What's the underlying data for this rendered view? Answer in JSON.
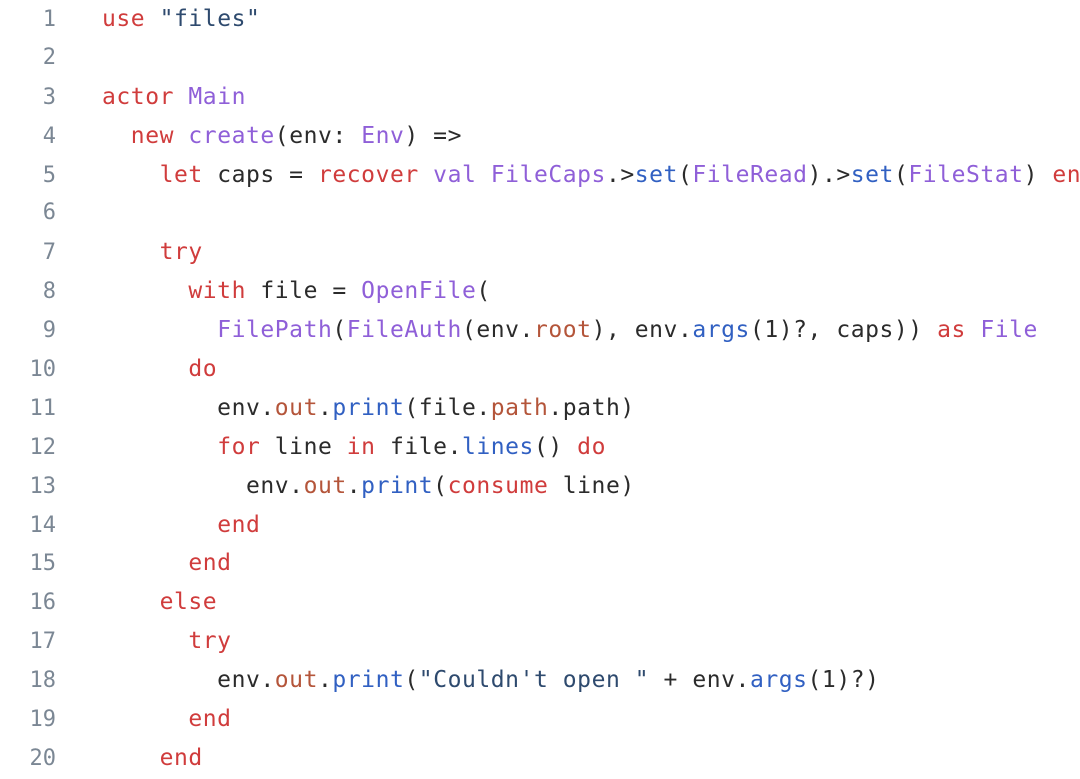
{
  "editor": {
    "language": "pony",
    "background_color": "#ffffff",
    "gutter_color": "#7b8794",
    "default_text_color": "#2b2b2b",
    "palette": {
      "keyword": "#d03c3c",
      "type": "#8f5fd8",
      "method": "#3160c2",
      "field": "#b4553a",
      "string": "#2e4a6e",
      "plain": "#2b2b2b"
    },
    "line_count": 20,
    "lines": [
      {
        "number": "1",
        "text": "use \"files\"",
        "tokens": [
          {
            "t": "use",
            "c": "kw"
          },
          {
            "t": " ",
            "c": "plain"
          },
          {
            "t": "\"files\"",
            "c": "string"
          }
        ]
      },
      {
        "number": "2",
        "text": "",
        "tokens": []
      },
      {
        "number": "3",
        "text": "actor Main",
        "tokens": [
          {
            "t": "actor",
            "c": "kw"
          },
          {
            "t": " ",
            "c": "plain"
          },
          {
            "t": "Main",
            "c": "type"
          }
        ]
      },
      {
        "number": "4",
        "text": "  new create(env: Env) =>",
        "tokens": [
          {
            "t": "  ",
            "c": "plain"
          },
          {
            "t": "new",
            "c": "kw"
          },
          {
            "t": " ",
            "c": "plain"
          },
          {
            "t": "create",
            "c": "type"
          },
          {
            "t": "(env: ",
            "c": "plain"
          },
          {
            "t": "Env",
            "c": "type"
          },
          {
            "t": ") =>",
            "c": "plain"
          }
        ]
      },
      {
        "number": "5",
        "text": "    let caps = recover val FileCaps.>set(FileRead).>set(FileStat) end",
        "tokens": [
          {
            "t": "    ",
            "c": "plain"
          },
          {
            "t": "let",
            "c": "kw"
          },
          {
            "t": " caps = ",
            "c": "plain"
          },
          {
            "t": "recover",
            "c": "kw"
          },
          {
            "t": " ",
            "c": "plain"
          },
          {
            "t": "val",
            "c": "type"
          },
          {
            "t": " ",
            "c": "plain"
          },
          {
            "t": "FileCaps",
            "c": "type"
          },
          {
            "t": ".>",
            "c": "plain"
          },
          {
            "t": "set",
            "c": "method"
          },
          {
            "t": "(",
            "c": "plain"
          },
          {
            "t": "FileRead",
            "c": "type"
          },
          {
            "t": ").>",
            "c": "plain"
          },
          {
            "t": "set",
            "c": "method"
          },
          {
            "t": "(",
            "c": "plain"
          },
          {
            "t": "FileStat",
            "c": "type"
          },
          {
            "t": ") ",
            "c": "plain"
          },
          {
            "t": "end",
            "c": "kw"
          }
        ]
      },
      {
        "number": "6",
        "text": "",
        "tokens": []
      },
      {
        "number": "7",
        "text": "    try",
        "tokens": [
          {
            "t": "    ",
            "c": "plain"
          },
          {
            "t": "try",
            "c": "kw"
          }
        ]
      },
      {
        "number": "8",
        "text": "      with file = OpenFile(",
        "tokens": [
          {
            "t": "      ",
            "c": "plain"
          },
          {
            "t": "with",
            "c": "kw"
          },
          {
            "t": " file = ",
            "c": "plain"
          },
          {
            "t": "OpenFile",
            "c": "type"
          },
          {
            "t": "(",
            "c": "plain"
          }
        ]
      },
      {
        "number": "9",
        "text": "        FilePath(FileAuth(env.root), env.args(1)?, caps)) as File",
        "tokens": [
          {
            "t": "        ",
            "c": "plain"
          },
          {
            "t": "FilePath",
            "c": "type"
          },
          {
            "t": "(",
            "c": "plain"
          },
          {
            "t": "FileAuth",
            "c": "type"
          },
          {
            "t": "(env.",
            "c": "plain"
          },
          {
            "t": "root",
            "c": "field"
          },
          {
            "t": "), env.",
            "c": "plain"
          },
          {
            "t": "args",
            "c": "method"
          },
          {
            "t": "(1)?, caps)) ",
            "c": "plain"
          },
          {
            "t": "as",
            "c": "kw"
          },
          {
            "t": " ",
            "c": "plain"
          },
          {
            "t": "File",
            "c": "type"
          }
        ]
      },
      {
        "number": "10",
        "text": "      do",
        "tokens": [
          {
            "t": "      ",
            "c": "plain"
          },
          {
            "t": "do",
            "c": "kw"
          }
        ]
      },
      {
        "number": "11",
        "text": "        env.out.print(file.path.path)",
        "tokens": [
          {
            "t": "        env.",
            "c": "plain"
          },
          {
            "t": "out",
            "c": "field"
          },
          {
            "t": ".",
            "c": "plain"
          },
          {
            "t": "print",
            "c": "method"
          },
          {
            "t": "(file.",
            "c": "plain"
          },
          {
            "t": "path",
            "c": "field"
          },
          {
            "t": ".path)",
            "c": "plain"
          }
        ]
      },
      {
        "number": "12",
        "text": "        for line in file.lines() do",
        "tokens": [
          {
            "t": "        ",
            "c": "plain"
          },
          {
            "t": "for",
            "c": "kw"
          },
          {
            "t": " line ",
            "c": "plain"
          },
          {
            "t": "in",
            "c": "kw"
          },
          {
            "t": " file.",
            "c": "plain"
          },
          {
            "t": "lines",
            "c": "method"
          },
          {
            "t": "() ",
            "c": "plain"
          },
          {
            "t": "do",
            "c": "kw"
          }
        ]
      },
      {
        "number": "13",
        "text": "          env.out.print(consume line)",
        "tokens": [
          {
            "t": "          env.",
            "c": "plain"
          },
          {
            "t": "out",
            "c": "field"
          },
          {
            "t": ".",
            "c": "plain"
          },
          {
            "t": "print",
            "c": "method"
          },
          {
            "t": "(",
            "c": "plain"
          },
          {
            "t": "consume",
            "c": "kw"
          },
          {
            "t": " line)",
            "c": "plain"
          }
        ]
      },
      {
        "number": "14",
        "text": "        end",
        "tokens": [
          {
            "t": "        ",
            "c": "plain"
          },
          {
            "t": "end",
            "c": "kw"
          }
        ]
      },
      {
        "number": "15",
        "text": "      end",
        "tokens": [
          {
            "t": "      ",
            "c": "plain"
          },
          {
            "t": "end",
            "c": "kw"
          }
        ]
      },
      {
        "number": "16",
        "text": "    else",
        "tokens": [
          {
            "t": "    ",
            "c": "plain"
          },
          {
            "t": "else",
            "c": "kw"
          }
        ]
      },
      {
        "number": "17",
        "text": "      try",
        "tokens": [
          {
            "t": "      ",
            "c": "plain"
          },
          {
            "t": "try",
            "c": "kw"
          }
        ]
      },
      {
        "number": "18",
        "text": "        env.out.print(\"Couldn't open \" + env.args(1)?)",
        "tokens": [
          {
            "t": "        env.",
            "c": "plain"
          },
          {
            "t": "out",
            "c": "field"
          },
          {
            "t": ".",
            "c": "plain"
          },
          {
            "t": "print",
            "c": "method"
          },
          {
            "t": "(",
            "c": "plain"
          },
          {
            "t": "\"Couldn't open \"",
            "c": "string"
          },
          {
            "t": " + env.",
            "c": "plain"
          },
          {
            "t": "args",
            "c": "method"
          },
          {
            "t": "(1)?)",
            "c": "plain"
          }
        ]
      },
      {
        "number": "19",
        "text": "      end",
        "tokens": [
          {
            "t": "      ",
            "c": "plain"
          },
          {
            "t": "end",
            "c": "kw"
          }
        ]
      },
      {
        "number": "20",
        "text": "    end",
        "tokens": [
          {
            "t": "    ",
            "c": "plain"
          },
          {
            "t": "end",
            "c": "kw"
          }
        ]
      }
    ]
  }
}
